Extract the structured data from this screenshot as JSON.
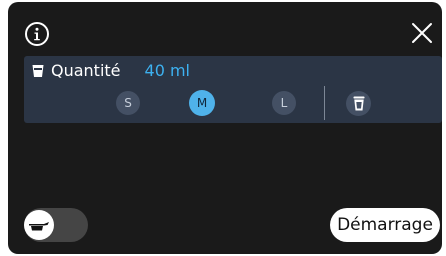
{
  "header": {
    "info_icon": "info-icon",
    "close_icon": "close-icon"
  },
  "quantity": {
    "icon": "cup-icon",
    "label": "Quantité",
    "value": "40 ml"
  },
  "sizes": [
    {
      "label": "S",
      "selected": false
    },
    {
      "label": "M",
      "selected": true
    },
    {
      "label": "L",
      "selected": false
    }
  ],
  "custom_cup_icon": "cup-icon",
  "toggle": {
    "icon": "milk-pitcher-icon",
    "on": false
  },
  "start_button": {
    "label": "Démarrage"
  },
  "colors": {
    "background": "#1a1a1a",
    "panel": "#2b3545",
    "accent": "#3db1f0",
    "selected_size": "#4fb2ea",
    "unselected_size": "#445064"
  }
}
